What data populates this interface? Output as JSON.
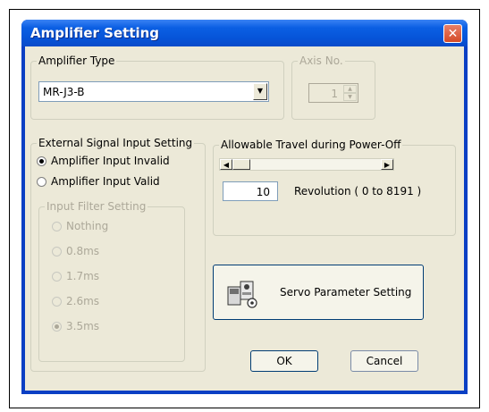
{
  "dialog": {
    "title": "Amplifier Setting",
    "close_symbol": "✕"
  },
  "amplifier_type": {
    "label": "Amplifier Type",
    "selected": "MR-J3-B"
  },
  "axis_no": {
    "label": "Axis No.",
    "value": "1"
  },
  "external_signal": {
    "label": "External Signal Input Setting",
    "options": [
      "Amplifier Input Invalid",
      "Amplifier Input Valid"
    ],
    "selected_index": 0
  },
  "input_filter": {
    "label": "Input Filter Setting",
    "options": [
      "Nothing",
      "0.8ms",
      "1.7ms",
      "2.6ms",
      "3.5ms"
    ],
    "selected_index": 4
  },
  "travel": {
    "label": "Allowable Travel during Power-Off",
    "value": "10",
    "unit_text": "Revolution ( 0 to 8191 )"
  },
  "buttons": {
    "servo": "Servo Parameter Setting",
    "ok": "OK",
    "cancel": "Cancel"
  },
  "icons": {
    "servo": "servo-amplifier-icon"
  }
}
